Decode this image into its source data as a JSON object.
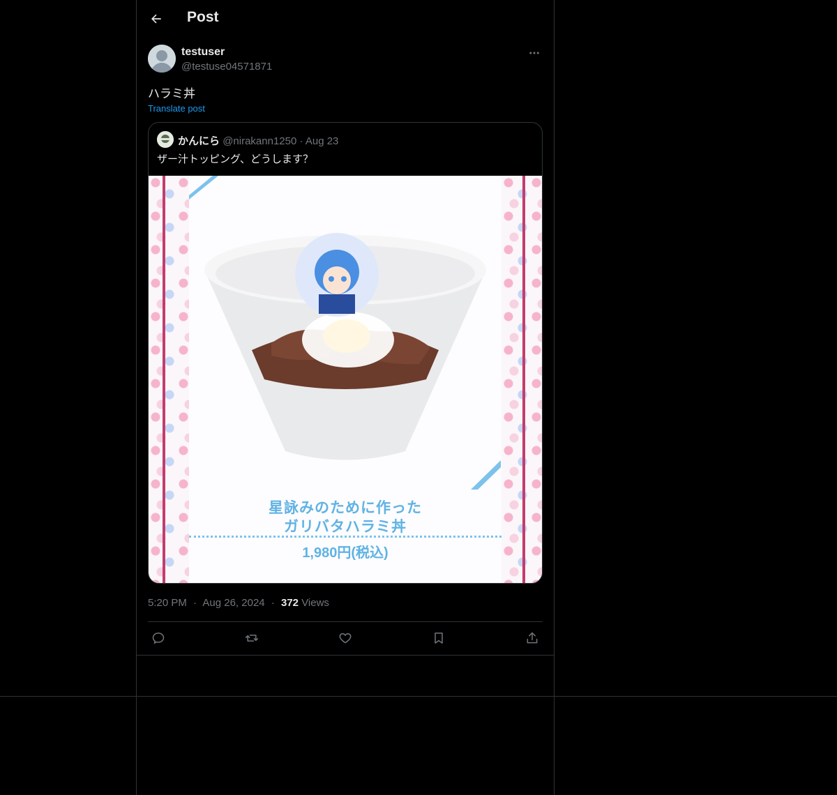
{
  "header": {
    "title": "Post"
  },
  "post": {
    "author_name": "testuser",
    "author_handle": "@testuse04571871",
    "text": "ハラミ丼",
    "translate_label": "Translate post",
    "time": "5:20 PM",
    "date": "Aug 26, 2024",
    "views_count": "372",
    "views_label": "Views",
    "separator": "·"
  },
  "quote": {
    "author_name": "かんにら",
    "author_handle": "@nirakann1250",
    "separator": "·",
    "date": "Aug 23",
    "text": "ザー汁トッピング、どうします？",
    "image": {
      "caption_line1": "星詠みのために作った",
      "caption_line2": "ガリバタハラミ丼",
      "price": "1,980円(税込)"
    }
  },
  "icons": {
    "back": "arrow-left-icon",
    "more": "more-icon",
    "reply": "reply-icon",
    "repost": "repost-icon",
    "like": "heart-icon",
    "bookmark": "bookmark-icon",
    "share": "share-icon"
  },
  "colors": {
    "background": "#000000",
    "text": "#e7e9ea",
    "muted": "#71767b",
    "accent": "#1d9bf0",
    "border": "#2f3336"
  }
}
